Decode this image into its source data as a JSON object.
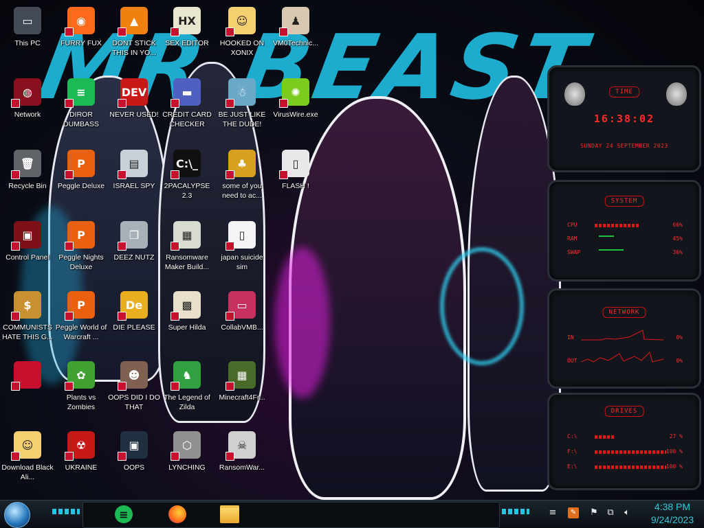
{
  "wallpaper": {
    "text": "MR BEAST"
  },
  "desktop_icons": [
    {
      "label": "This PC",
      "icon": "this-pc-icon",
      "color": "#444a56",
      "glyph": "▭"
    },
    {
      "label": "FURRY FUX",
      "icon": "firefox-icon",
      "color": "#ff6a1a",
      "glyph": "◉"
    },
    {
      "label": "DONT STICK THIS IN YO...",
      "icon": "vlc-cone-icon",
      "color": "#f08010",
      "glyph": "▲"
    },
    {
      "label": "SEX EDITOR",
      "icon": "hex-editor-icon",
      "color": "#e9e6d0",
      "glyph": "HX"
    },
    {
      "label": "HOOKED ON XONIX",
      "icon": "cartoon-face-icon",
      "color": "#f4d070",
      "glyph": "☺"
    },
    {
      "label": "VM0Technic...",
      "icon": "doctor-avatar-icon",
      "color": "#d8c8b0",
      "glyph": "♟"
    },
    {
      "label": "Network",
      "icon": "network-globe-icon",
      "color": "#8a1020",
      "glyph": "◍"
    },
    {
      "label": "DIROR DUMBASS",
      "icon": "green-app-icon",
      "color": "#1db954",
      "glyph": "≡"
    },
    {
      "label": "NEVER USED!",
      "icon": "dev-cpp-icon",
      "color": "#c81818",
      "glyph": "DEV"
    },
    {
      "label": "CREDIT CARD CHECKER",
      "icon": "credit-card-icon",
      "color": "#5060c0",
      "glyph": "▬"
    },
    {
      "label": "BE JUST LIKE THE DUDE!",
      "icon": "santa-face-icon",
      "color": "#6aa8c8",
      "glyph": "☃"
    },
    {
      "label": "VirusWire.exe",
      "icon": "lime-icon",
      "color": "#7ccc20",
      "glyph": "✺"
    },
    {
      "label": "Recycle Bin",
      "icon": "recycle-bin-icon",
      "color": "#606468",
      "glyph": "🗑"
    },
    {
      "label": "Peggle Deluxe",
      "icon": "peggle-icon",
      "color": "#e86010",
      "glyph": "P"
    },
    {
      "label": "ISRAEL SPY",
      "icon": "monitor-icon",
      "color": "#c8d0d8",
      "glyph": "▤"
    },
    {
      "label": "2PACALYPSE 2.3",
      "icon": "terminal-icon",
      "color": "#101010",
      "glyph": "C:\\_"
    },
    {
      "label": "some of you need to ac...",
      "icon": "dog-cartoon-icon",
      "color": "#d8a020",
      "glyph": "♣"
    },
    {
      "label": "FLASH !",
      "icon": "document-icon",
      "color": "#e8e8e8",
      "glyph": "▯"
    },
    {
      "label": "Control Panel",
      "icon": "control-panel-icon",
      "color": "#801018",
      "glyph": "▣"
    },
    {
      "label": "Peggle Nights Deluxe",
      "icon": "peggle-nights-icon",
      "color": "#e86010",
      "glyph": "P"
    },
    {
      "label": "DEEZ NUTZ",
      "icon": "windows-stack-icon",
      "color": "#a8b0b8",
      "glyph": "❐"
    },
    {
      "label": "Ransomware Maker Build...",
      "icon": "app-window-icon",
      "color": "#d8dcd0",
      "glyph": "▦"
    },
    {
      "label": "japan suicide sim",
      "icon": "blank-file-icon",
      "color": "#f4f4f4",
      "glyph": "▯"
    },
    {
      "label": "COMMUNISTS HATE THIS G...",
      "icon": "money-bag-icon",
      "color": "#c89030",
      "glyph": "$"
    },
    {
      "label": "Peggle World of Warcraft ...",
      "icon": "peggle-wow-icon",
      "color": "#e86010",
      "glyph": "P"
    },
    {
      "label": "DIE PLEASE",
      "icon": "dlang-icon",
      "color": "#e8b020",
      "glyph": "De"
    },
    {
      "label": "Super Hilda",
      "icon": "pixel-dog-icon",
      "color": "#e8e0c8",
      "glyph": "▩"
    },
    {
      "label": "CollabVMB...",
      "icon": "vm-monitor-icon",
      "color": "#c83060",
      "glyph": "▭"
    },
    {
      "label": "",
      "icon": "red-file-icon",
      "color": "#c8102e",
      "glyph": ""
    },
    {
      "label": "Plants vs Zombies",
      "icon": "plants-vs-zombies-icon",
      "color": "#40a030",
      "glyph": "✿"
    },
    {
      "label": "OOPS DID I DO THAT",
      "icon": "portrait-icon",
      "color": "#806050",
      "glyph": "☻"
    },
    {
      "label": "The Legend of Zilda",
      "icon": "zelda-icon",
      "color": "#30a040",
      "glyph": "♞"
    },
    {
      "label": "Minecraft4Fr...",
      "icon": "minecraft-block-icon",
      "color": "#4a6a2a",
      "glyph": "▦"
    },
    {
      "label": "Download Black Ali...",
      "icon": "cartoon-girl-icon",
      "color": "#f4d070",
      "glyph": "☺"
    },
    {
      "label": "UKRAINE",
      "icon": "radiation-icon",
      "color": "#c81818",
      "glyph": "☢"
    },
    {
      "label": "OOPS",
      "icon": "dark-app-icon",
      "color": "#203040",
      "glyph": "▣"
    },
    {
      "label": "LYNCHING",
      "icon": "shield-badge-icon",
      "color": "#909090",
      "glyph": "⬡"
    },
    {
      "label": "RansomWar...",
      "icon": "skull-icon",
      "color": "#d0d0d0",
      "glyph": "☠"
    }
  ],
  "widgets": {
    "time": {
      "title": "TIME",
      "clock": "16:38:02",
      "date": "SUNDAY 24 SEPTEMBER 2023"
    },
    "system": {
      "title": "SYSTEM",
      "rows": [
        {
          "name": "CPU",
          "value": "66%",
          "level": 0.66
        },
        {
          "name": "RAM",
          "value": "45%",
          "level": 0.45
        },
        {
          "name": "SWAP",
          "value": "36%",
          "level": 0.36
        }
      ]
    },
    "network": {
      "title": "NETWORK",
      "rows": [
        {
          "name": "IN",
          "value": "0%"
        },
        {
          "name": "OUT",
          "value": "0%"
        }
      ]
    },
    "drives": {
      "title": "DRIVES",
      "rows": [
        {
          "name": "C:\\",
          "value": "27 %",
          "level": 0.27
        },
        {
          "name": "F:\\",
          "value": "100 %",
          "level": 1.0
        },
        {
          "name": "E:\\",
          "value": "100 %",
          "level": 1.0
        }
      ]
    }
  },
  "taskbar": {
    "apps": [
      "green-app-icon",
      "firefox-icon",
      "file-explorer-icon"
    ],
    "clock": {
      "time": "4:38 PM",
      "date": "9/24/2023"
    }
  }
}
